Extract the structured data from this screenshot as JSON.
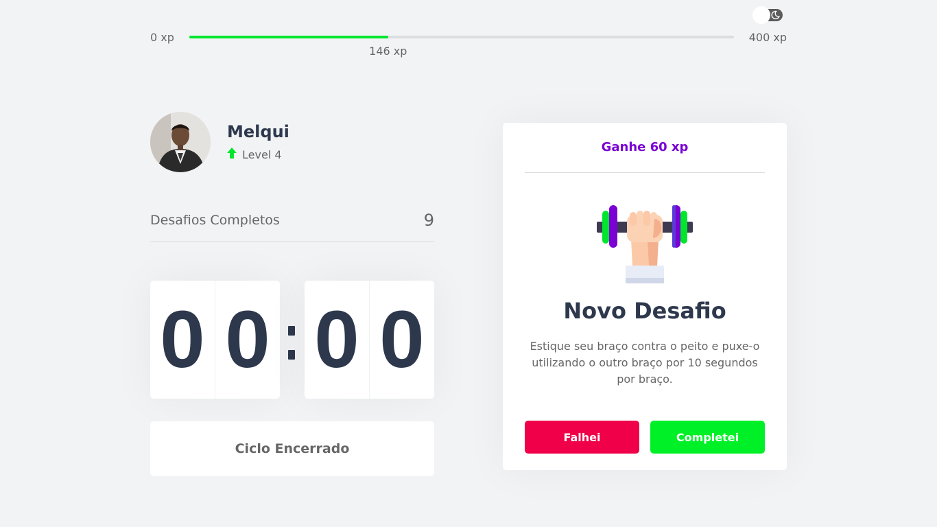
{
  "theme_toggle": {
    "icon": "moon-icon",
    "state": "light"
  },
  "experience": {
    "min_label": "0 xp",
    "max_label": "400 xp",
    "current_label": "146 xp",
    "current": 146,
    "max": 400
  },
  "profile": {
    "name": "Melqui",
    "level_label": "Level 4",
    "level_icon": "level-up-arrow-icon"
  },
  "completed_challenges": {
    "label": "Desafios Completos",
    "count": "9"
  },
  "countdown": {
    "minute_left": "0",
    "minute_right": "0",
    "second_left": "0",
    "second_right": "0"
  },
  "cycle_button": {
    "label": "Ciclo Encerrado"
  },
  "challenge": {
    "header": "Ganhe 60 xp",
    "illustration": "dumbbell-icon",
    "title": "Novo Desafio",
    "description": "Estique seu braço contra o peito e puxe-o utilizando o outro braço por 10 segundos por braço.",
    "fail_label": "Falhei",
    "complete_label": "Completei"
  },
  "colors": {
    "background": "#f2f3f5",
    "xp_fill": "#00e62e",
    "accent_purple": "#7a00d4",
    "fail": "#ef0049",
    "success": "#00f028",
    "title": "#2e384d",
    "text": "#666666"
  }
}
